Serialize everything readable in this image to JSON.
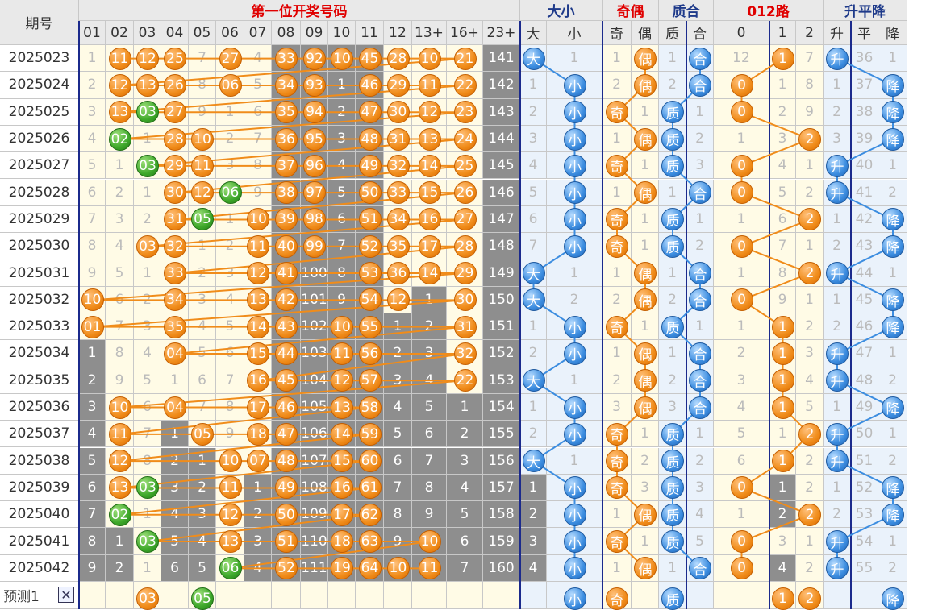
{
  "header": {
    "issue_label": "期号",
    "groups": [
      {
        "label": "第一位开奖号码",
        "color": "red"
      },
      {
        "label": "大小",
        "color": "blue"
      },
      {
        "label": "奇偶",
        "color": "red"
      },
      {
        "label": "质合",
        "color": "blue"
      },
      {
        "label": "012路",
        "color": "red"
      },
      {
        "label": "升平降",
        "color": "blue"
      }
    ],
    "columns": [
      "01",
      "02",
      "03",
      "04",
      "05",
      "06",
      "07",
      "08",
      "09",
      "10",
      "11",
      "12",
      "13+",
      "16+",
      "23+",
      "大",
      "小",
      "奇",
      "偶",
      "质",
      "合",
      "0",
      "1",
      "2",
      "升",
      "平",
      "降"
    ]
  },
  "rows": [
    {
      "issue": "2025023",
      "cells": [
        "1",
        "11",
        "12",
        "25",
        "7",
        "27",
        "4",
        "33",
        "92",
        "10",
        "45",
        "28",
        "10",
        "21",
        "141",
        "大",
        "1",
        "1",
        "偶",
        "1",
        "合",
        "12",
        "1",
        "7",
        "升",
        "36",
        "1"
      ]
    },
    {
      "issue": "2025024",
      "cells": [
        "2",
        "12",
        "13",
        "26",
        "8",
        "06",
        "5",
        "34",
        "93",
        "1",
        "46",
        "29",
        "11",
        "22",
        "142",
        "1",
        "小",
        "2",
        "偶",
        "2",
        "合",
        "0",
        "1",
        "8",
        "1",
        "37",
        "降"
      ]
    },
    {
      "issue": "2025025",
      "cells": [
        "3",
        "13",
        "03",
        "27",
        "9",
        "1",
        "6",
        "35",
        "94",
        "2",
        "47",
        "30",
        "12",
        "23",
        "143",
        "2",
        "小",
        "奇",
        "1",
        "质",
        "1",
        "0",
        "2",
        "9",
        "2",
        "38",
        "降"
      ]
    },
    {
      "issue": "2025026",
      "cells": [
        "4",
        "02",
        "1",
        "28",
        "10",
        "2",
        "7",
        "36",
        "95",
        "3",
        "48",
        "31",
        "13",
        "24",
        "144",
        "3",
        "小",
        "1",
        "偶",
        "质",
        "2",
        "1",
        "3",
        "2",
        "3",
        "39",
        "降"
      ]
    },
    {
      "issue": "2025027",
      "cells": [
        "5",
        "1",
        "03",
        "29",
        "11",
        "3",
        "8",
        "37",
        "96",
        "4",
        "49",
        "32",
        "14",
        "25",
        "145",
        "4",
        "小",
        "奇",
        "1",
        "质",
        "3",
        "0",
        "4",
        "1",
        "升",
        "40",
        "1"
      ]
    },
    {
      "issue": "2025028",
      "cells": [
        "6",
        "2",
        "1",
        "30",
        "12",
        "06",
        "9",
        "38",
        "97",
        "5",
        "50",
        "33",
        "15",
        "26",
        "146",
        "5",
        "小",
        "1",
        "偶",
        "1",
        "合",
        "0",
        "5",
        "2",
        "升",
        "41",
        "2"
      ]
    },
    {
      "issue": "2025029",
      "cells": [
        "7",
        "3",
        "2",
        "31",
        "05",
        "1",
        "10",
        "39",
        "98",
        "6",
        "51",
        "34",
        "16",
        "27",
        "147",
        "6",
        "小",
        "奇",
        "1",
        "质",
        "1",
        "1",
        "6",
        "2",
        "1",
        "42",
        "降"
      ]
    },
    {
      "issue": "2025030",
      "cells": [
        "8",
        "4",
        "03",
        "32",
        "1",
        "2",
        "11",
        "40",
        "99",
        "7",
        "52",
        "35",
        "17",
        "28",
        "148",
        "7",
        "小",
        "奇",
        "1",
        "质",
        "2",
        "0",
        "7",
        "1",
        "2",
        "43",
        "降"
      ]
    },
    {
      "issue": "2025031",
      "cells": [
        "9",
        "5",
        "1",
        "33",
        "2",
        "3",
        "12",
        "41",
        "100",
        "8",
        "53",
        "36",
        "14",
        "29",
        "149",
        "大",
        "1",
        "1",
        "偶",
        "1",
        "合",
        "1",
        "8",
        "2",
        "升",
        "44",
        "1"
      ]
    },
    {
      "issue": "2025032",
      "cells": [
        "10",
        "6",
        "2",
        "34",
        "3",
        "4",
        "13",
        "42",
        "101",
        "9",
        "54",
        "12",
        "1",
        "30",
        "150",
        "大",
        "2",
        "2",
        "偶",
        "2",
        "合",
        "0",
        "9",
        "1",
        "1",
        "45",
        "降"
      ]
    },
    {
      "issue": "2025033",
      "cells": [
        "01",
        "7",
        "3",
        "35",
        "4",
        "5",
        "14",
        "43",
        "102",
        "10",
        "55",
        "1",
        "2",
        "31",
        "151",
        "1",
        "小",
        "奇",
        "1",
        "质",
        "1",
        "1",
        "1",
        "2",
        "2",
        "46",
        "降"
      ]
    },
    {
      "issue": "2025034",
      "cells": [
        "1",
        "8",
        "4",
        "04",
        "5",
        "6",
        "15",
        "44",
        "103",
        "11",
        "56",
        "2",
        "3",
        "32",
        "152",
        "2",
        "小",
        "1",
        "偶",
        "1",
        "合",
        "2",
        "1",
        "3",
        "升",
        "47",
        "1"
      ]
    },
    {
      "issue": "2025035",
      "cells": [
        "2",
        "9",
        "5",
        "1",
        "6",
        "7",
        "16",
        "45",
        "104",
        "12",
        "57",
        "3",
        "4",
        "22",
        "153",
        "大",
        "1",
        "2",
        "偶",
        "2",
        "合",
        "3",
        "1",
        "4",
        "升",
        "48",
        "2"
      ]
    },
    {
      "issue": "2025036",
      "cells": [
        "3",
        "10",
        "6",
        "04",
        "7",
        "8",
        "17",
        "46",
        "105",
        "13",
        "58",
        "4",
        "5",
        "1",
        "154",
        "1",
        "小",
        "3",
        "偶",
        "3",
        "合",
        "4",
        "1",
        "5",
        "1",
        "49",
        "降"
      ]
    },
    {
      "issue": "2025037",
      "cells": [
        "4",
        "11",
        "7",
        "1",
        "05",
        "9",
        "18",
        "47",
        "106",
        "14",
        "59",
        "5",
        "6",
        "2",
        "155",
        "2",
        "小",
        "奇",
        "1",
        "质",
        "1",
        "5",
        "1",
        "2",
        "升",
        "50",
        "1"
      ]
    },
    {
      "issue": "2025038",
      "cells": [
        "5",
        "12",
        "8",
        "2",
        "1",
        "10",
        "07",
        "48",
        "107",
        "15",
        "60",
        "6",
        "7",
        "3",
        "156",
        "大",
        "1",
        "奇",
        "2",
        "质",
        "2",
        "6",
        "1",
        "2",
        "升",
        "51",
        "2"
      ]
    },
    {
      "issue": "2025039",
      "cells": [
        "6",
        "13",
        "03",
        "3",
        "2",
        "11",
        "1",
        "49",
        "108",
        "16",
        "61",
        "7",
        "8",
        "4",
        "157",
        "1",
        "小",
        "奇",
        "3",
        "质",
        "3",
        "0",
        "1",
        "2",
        "1",
        "52",
        "降"
      ]
    },
    {
      "issue": "2025040",
      "cells": [
        "7",
        "02",
        "1",
        "4",
        "3",
        "12",
        "2",
        "50",
        "109",
        "17",
        "62",
        "8",
        "9",
        "5",
        "158",
        "2",
        "小",
        "1",
        "偶",
        "质",
        "4",
        "1",
        "2",
        "2",
        "2",
        "53",
        "降"
      ]
    },
    {
      "issue": "2025041",
      "cells": [
        "8",
        "1",
        "03",
        "5",
        "4",
        "13",
        "3",
        "51",
        "110",
        "18",
        "63",
        "9",
        "10",
        "6",
        "159",
        "3",
        "小",
        "奇",
        "1",
        "质",
        "5",
        "0",
        "3",
        "1",
        "升",
        "54",
        "1"
      ]
    },
    {
      "issue": "2025042",
      "cells": [
        "9",
        "2",
        "1",
        "6",
        "5",
        "06",
        "4",
        "52",
        "111",
        "19",
        "64",
        "10",
        "11",
        "7",
        "160",
        "4",
        "小",
        "1",
        "偶",
        "1",
        "合",
        "0",
        "4",
        "2",
        "升",
        "55",
        "2"
      ]
    }
  ],
  "predict": {
    "label": "预测1",
    "close_icon": "close-icon",
    "balls": [
      "03",
      "05",
      "小",
      "奇",
      "质",
      "1",
      "2",
      "降"
    ]
  },
  "colors": {
    "orange": "#f08c1a",
    "green": "#3ea82a",
    "blue": "#3c8de0",
    "gray": "#8e8e8e",
    "warm": "#fffbe6",
    "cool": "#eaf2fb",
    "line": "#1b2a8c"
  }
}
